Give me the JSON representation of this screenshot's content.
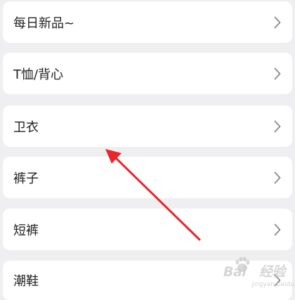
{
  "categories": [
    {
      "label": "每日新品~",
      "icon": "chevron-right-icon"
    },
    {
      "label": "T恤/背心",
      "icon": "chevron-right-icon"
    },
    {
      "label": "卫衣",
      "icon": "chevron-right-icon"
    },
    {
      "label": "裤子",
      "icon": "chevron-right-icon"
    },
    {
      "label": "短裤",
      "icon": "chevron-right-icon"
    },
    {
      "label": "潮鞋",
      "icon": "chevron-right-icon"
    }
  ],
  "annotation": {
    "type": "arrow",
    "color": "#e8262b",
    "points_to": "卫衣"
  },
  "watermark": {
    "brand": "Bai",
    "brand_suffix": "经验",
    "url": "jingyan.baidu.com"
  },
  "colors": {
    "background": "#efeff1",
    "card": "#ffffff",
    "text": "#222222",
    "chevron": "#8a8a8a"
  }
}
